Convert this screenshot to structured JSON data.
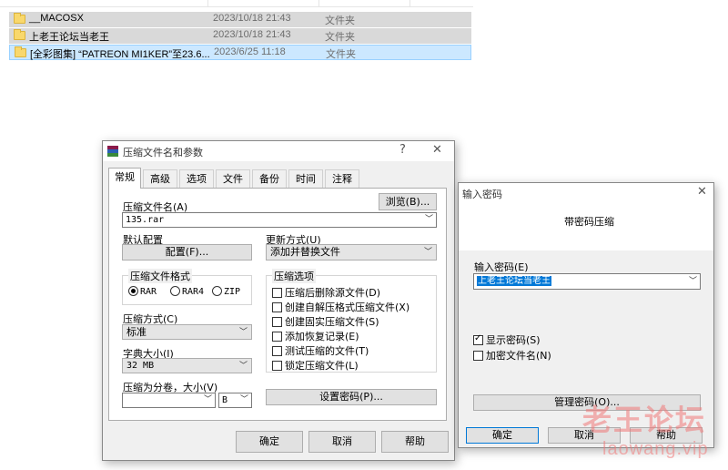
{
  "explorer": {
    "rows": [
      {
        "name": "__MACOSX",
        "date": "2023/10/18 21:43",
        "type": "文件夹"
      },
      {
        "name": "上老王论坛当老王",
        "date": "2023/10/18 21:43",
        "type": "文件夹"
      },
      {
        "name": "[全彩图集] “PATREON MI1KER”至23.6...",
        "date": "2023/6/25 11:18",
        "type": "文件夹"
      }
    ]
  },
  "archive_dialog": {
    "title": "压缩文件名和参数",
    "help_glyph": "?",
    "close_glyph": "✕",
    "tabs": [
      "常规",
      "高级",
      "选项",
      "文件",
      "备份",
      "时间",
      "注释"
    ],
    "archive_name_label": "压缩文件名(A)",
    "browse_button": "浏览(B)...",
    "archive_name_value": "135.rar",
    "default_profile_label": "默认配置",
    "profiles_button": "配置(F)...",
    "update_mode_label": "更新方式(U)",
    "update_mode_value": "添加并替换文件",
    "format_group_label": "压缩文件格式",
    "formats": [
      "RAR",
      "RAR4",
      "ZIP"
    ],
    "options_group_label": "压缩选项",
    "options": [
      {
        "label": "压缩后删除源文件(D)",
        "checked": false
      },
      {
        "label": "创建自解压格式压缩文件(X)",
        "checked": false
      },
      {
        "label": "创建固实压缩文件(S)",
        "checked": false
      },
      {
        "label": "添加恢复记录(E)",
        "checked": false
      },
      {
        "label": "测试压缩的文件(T)",
        "checked": false
      },
      {
        "label": "锁定压缩文件(L)",
        "checked": false
      }
    ],
    "method_label": "压缩方式(C)",
    "method_value": "标准",
    "dict_label": "字典大小(I)",
    "dict_value": "32 MB",
    "split_label": "压缩为分卷，大小(V)",
    "split_value": "",
    "split_unit": "B",
    "set_password_button": "设置密码(P)...",
    "ok_button": "确定",
    "cancel_button": "取消",
    "help_button": "帮助"
  },
  "password_dialog": {
    "title": "输入密码",
    "close_glyph": "✕",
    "heading": "带密码压缩",
    "password_label": "输入密码(E)",
    "password_value": "上老王论坛当老王",
    "show_password_label": "显示密码(S)",
    "show_password_checked": true,
    "encrypt_names_label": "加密文件名(N)",
    "encrypt_names_checked": false,
    "organize_button": "管理密码(O)...",
    "ok_button": "确定",
    "cancel_button": "取消",
    "help_button": "帮助"
  },
  "watermark": {
    "line1": "老王论坛",
    "line2": "laowang.vip"
  },
  "colors": {
    "selection": "#cce8ff",
    "dialog_bg": "#f0f0f0",
    "button_bg": "#e1e1e1"
  }
}
